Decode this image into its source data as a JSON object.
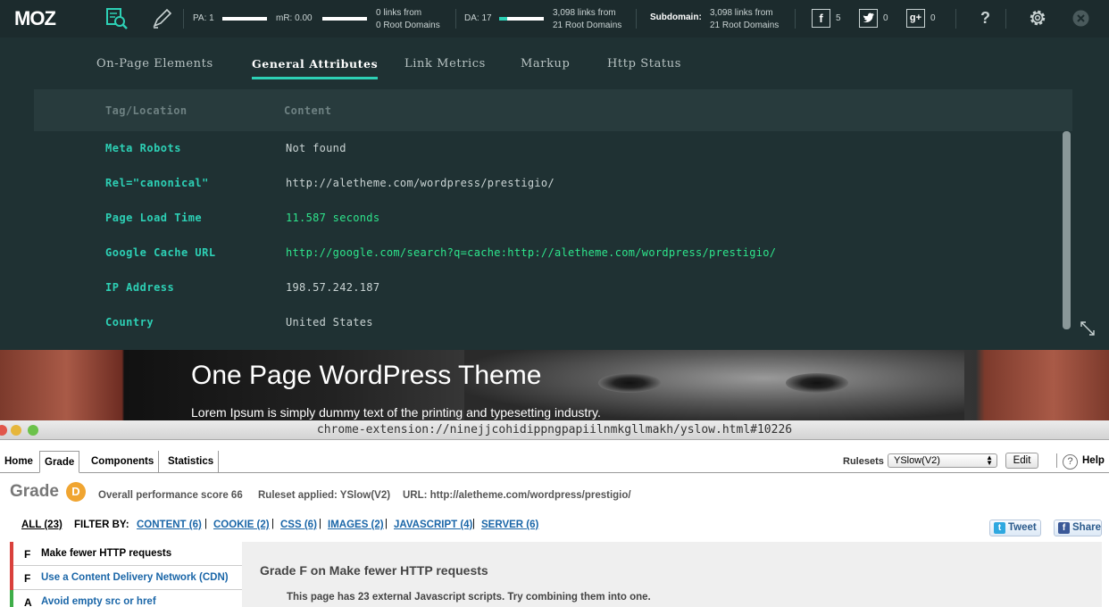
{
  "mozbar": {
    "logo": "MOZ",
    "pa_label": "PA: 1",
    "pa_fill": 0.0,
    "mr_label": "mR: 0.00",
    "mr_fill": 0.0,
    "page_links_line1": "0 links from",
    "page_links_line2": "0 Root Domains",
    "da_label": "DA: 17",
    "da_fill": 0.17,
    "domain_links_line1": "3,098 links from",
    "domain_links_line2": "21 Root Domains",
    "subdomain_label": "Subdomain:",
    "subdomain_links_line1": "3,098 links from",
    "subdomain_links_line2": "21 Root Domains",
    "facebook_glyph": "f",
    "facebook_count": "5",
    "twitter_count": "0",
    "googleplus_glyph": "g+",
    "googleplus_count": "0",
    "help_glyph": "?",
    "accent_color": "#2dd0b5"
  },
  "panel": {
    "tabs": [
      "On-Page Elements",
      "General Attributes",
      "Link Metrics",
      "Markup",
      "Http Status"
    ],
    "active_tab": "General Attributes",
    "columns": [
      "Tag/Location",
      "Content"
    ],
    "rows": [
      {
        "key": "Meta Robots",
        "value": "Not found"
      },
      {
        "key": "Rel=\"canonical\"",
        "value": "http://aletheme.com/wordpress/prestigio/"
      },
      {
        "key": "Page Load Time",
        "value": "11.587 seconds"
      },
      {
        "key": "Google Cache URL",
        "value": "http://google.com/search?q=cache:http://aletheme.com/wordpress/prestigio/"
      },
      {
        "key": "IP Address",
        "value": "198.57.242.187"
      },
      {
        "key": "Country",
        "value": "United States"
      }
    ]
  },
  "hero": {
    "title": "One Page WordPress Theme",
    "subtitle": "Lorem Ipsum is simply dummy text of the printing and typesetting industry."
  },
  "yslow": {
    "window_url": "chrome-extension://ninejjcohidippngpapiilnmkgllmakh/yslow.html#10226",
    "tabs": [
      "Home",
      "Grade",
      "Components",
      "Statistics"
    ],
    "active_tab": "Grade",
    "rulesets_label": "Rulesets",
    "ruleset_selected": "YSlow(V2)",
    "edit_label": "Edit",
    "help_label": "Help",
    "grade_title": "Grade",
    "grade_letter": "D",
    "score_text": "Overall performance score 66",
    "ruleset_text": "Ruleset applied: YSlow(V2)",
    "url_text": "URL: http://aletheme.com/wordpress/prestigio/",
    "filter_all": "ALL (23)",
    "filter_by": "FILTER BY:",
    "filters": [
      "CONTENT (6)",
      "COOKIE (2)",
      "CSS (6)",
      "IMAGES (2)",
      "JAVASCRIPT (4)",
      "SERVER (6)"
    ],
    "tweet_label": "Tweet",
    "share_label": "Share",
    "items": [
      {
        "grade": "F",
        "label": "Make fewer HTTP requests"
      },
      {
        "grade": "F",
        "label": "Use a Content Delivery Network (CDN)"
      },
      {
        "grade": "A",
        "label": "Avoid empty src or href"
      }
    ],
    "detail_title": "Grade F on Make fewer HTTP requests",
    "detail_text": "This page has 23 external Javascript scripts. Try combining them into one."
  }
}
